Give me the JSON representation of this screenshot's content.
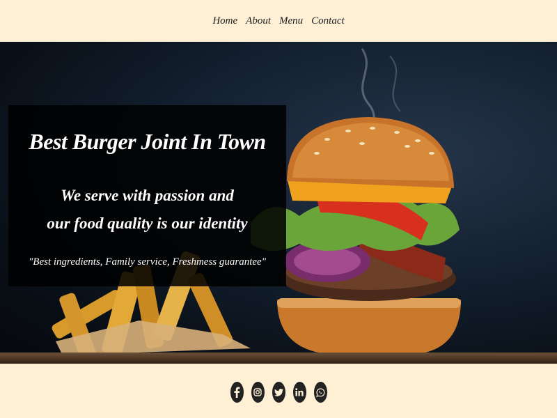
{
  "nav": {
    "items": [
      {
        "label": "Home"
      },
      {
        "label": "About"
      },
      {
        "label": "Menu"
      },
      {
        "label": "Contact"
      }
    ]
  },
  "hero": {
    "title": "Best Burger Joint In Town",
    "tagline_line1": "We serve with passion and",
    "tagline_line2": "our food quality is our identity",
    "quote": "\"Best ingredients, Family service, Freshmess guarantee\""
  },
  "footer": {
    "socials": [
      {
        "icon": "facebook-icon"
      },
      {
        "icon": "instagram-icon"
      },
      {
        "icon": "twitter-icon"
      },
      {
        "icon": "linkedin-icon"
      },
      {
        "icon": "whatsapp-icon"
      }
    ]
  },
  "colors": {
    "page_background": "#fdf0d5",
    "hero_dark": "#0a1018",
    "overlay": "#000000",
    "icon_fill": "#222222"
  }
}
